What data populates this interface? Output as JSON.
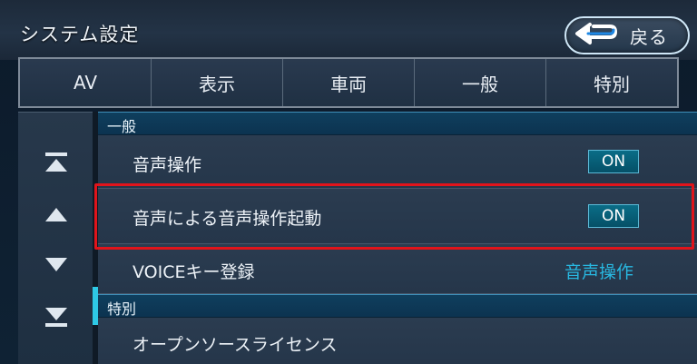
{
  "header": {
    "title": "システム設定",
    "back_label": "戻る"
  },
  "tabs": [
    "AV",
    "表示",
    "車両",
    "一般",
    "特別"
  ],
  "side_controls": [
    "scroll-top-icon",
    "scroll-up-icon",
    "scroll-down-icon",
    "scroll-bottom-icon"
  ],
  "list": {
    "section1": "一般",
    "row1": {
      "label": "音声操作",
      "value": "ON"
    },
    "row2": {
      "label": "音声による音声操作起動",
      "value": "ON"
    },
    "row3": {
      "label": "VOICEキー登録",
      "value": "音声操作"
    },
    "section2": "特別",
    "row4": {
      "label": "オープンソースライセンス"
    }
  },
  "colors": {
    "accent": "#2ec9e6",
    "highlight": "#e0141b",
    "value_text": "#28b7e0"
  }
}
